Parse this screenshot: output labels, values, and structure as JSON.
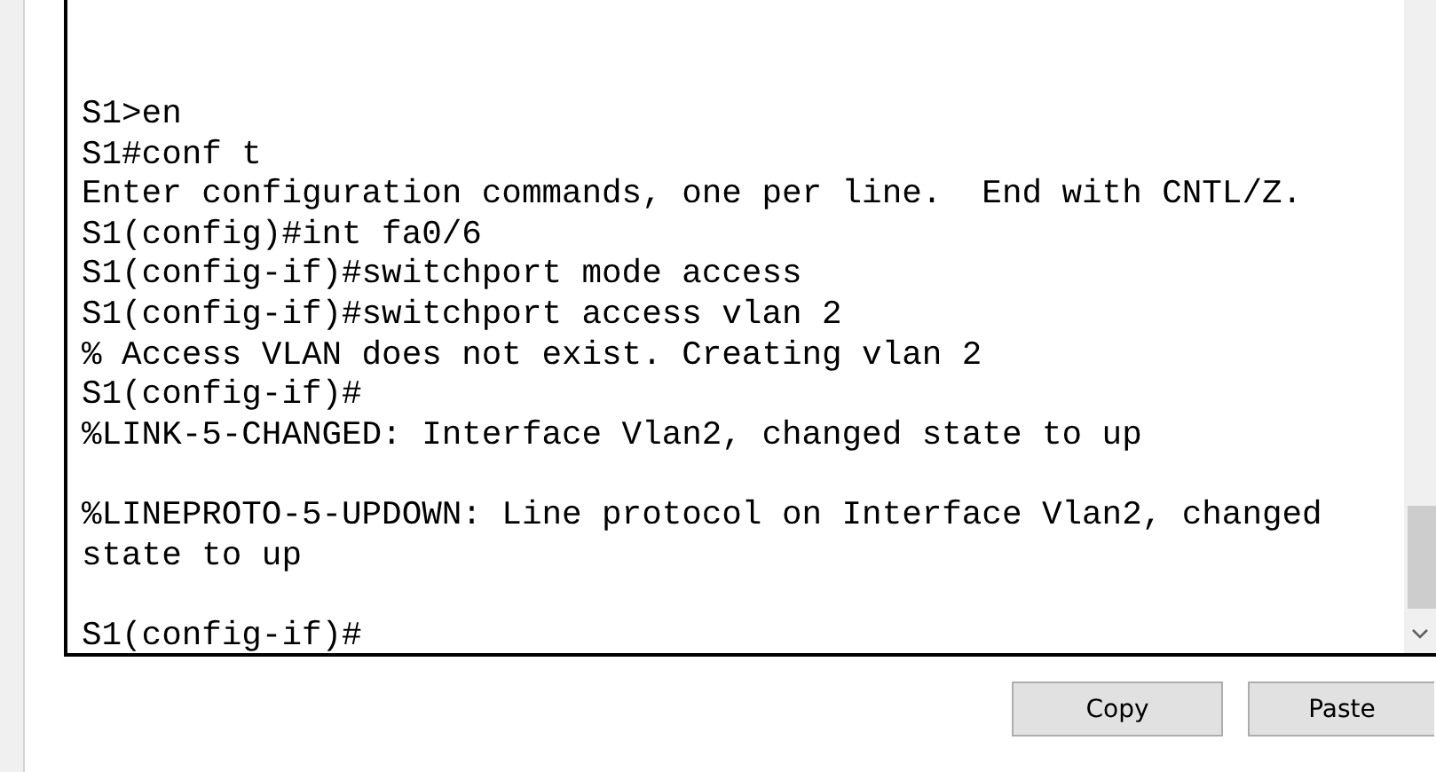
{
  "terminal": {
    "blocks": [
      {
        "lines": [
          "S1>en",
          "S1#conf t",
          "Enter configuration commands, one per line.  End with CNTL/Z.",
          "S1(config)#int fa0/6",
          "S1(config-if)#switchport mode access",
          "S1(config-if)#switchport access vlan 2",
          "% Access VLAN does not exist. Creating vlan 2",
          "S1(config-if)#",
          "%LINK-5-CHANGED: Interface Vlan2, changed state to up"
        ]
      },
      {
        "lines": [
          "%LINEPROTO-5-UPDOWN: Line protocol on Interface Vlan2, changed state to up"
        ]
      },
      {
        "lines": [
          "S1(config-if)#"
        ]
      }
    ]
  },
  "buttons": [
    {
      "label": "Copy"
    },
    {
      "label": "Paste"
    }
  ]
}
